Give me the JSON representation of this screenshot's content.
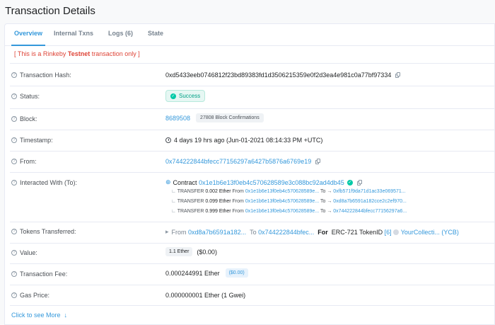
{
  "page": {
    "title": "Transaction Details"
  },
  "tabs": [
    {
      "label": "Overview"
    },
    {
      "label": "Internal Txns"
    },
    {
      "label": "Logs (6)"
    },
    {
      "label": "State"
    }
  ],
  "notice": {
    "prefix": "[ This is a Rinkeby ",
    "bold": "Testnet",
    "suffix": " transaction only ]"
  },
  "fields": {
    "hash": {
      "label": "Transaction Hash:",
      "value": "0xd5433eeb0746812f23bd89383fd1d3506215359e0f2d3ea4e981c0a77bf97334"
    },
    "status": {
      "label": "Status:",
      "value": "Success"
    },
    "block": {
      "label": "Block:",
      "value": "8689508",
      "confirmations": "27808 Block Confirmations"
    },
    "timestamp": {
      "label": "Timestamp:",
      "value": "4 days 19 hrs ago (Jun-01-2021 08:14:33 PM +UTC)"
    },
    "from": {
      "label": "From:",
      "value": "0x744222844bfecc77156297a6427b5876a6769e19"
    },
    "interacted": {
      "label": "Interacted With (To):",
      "prefix": "Contract",
      "address": "0x1e1b6e13f0eb4c570628589e3c088bc92ad4db45",
      "transfers": [
        {
          "kind": "TRANSFER",
          "amount": "0.002 Ether",
          "from_label": "From",
          "from": "0x1e1b6e13f0eb4c570628589e...",
          "to_label": "To →",
          "to": "0xfb571f9da71d1ac33e069571..."
        },
        {
          "kind": "TRANSFER",
          "amount": "0.099 Ether",
          "from_label": "From",
          "from": "0x1e1b6e13f0eb4c570628589e...",
          "to_label": "To →",
          "to": "0xd8a7b6591a182cce2c2ef970..."
        },
        {
          "kind": "TRANSFER",
          "amount": "0.999 Ether",
          "from_label": "From",
          "from": "0x1e1b6e13f0eb4c570628589e...",
          "to_label": "To →",
          "to": "0x744222844bfecc77156297a6..."
        }
      ]
    },
    "tokens": {
      "label": "Tokens Transferred:",
      "from_label": "From",
      "from": "0xd8a7b6591a182...",
      "to_label": "To",
      "to": "0x744222844bfec...",
      "for_label": "For",
      "standard": "ERC-721 TokenID",
      "token_id": "[6]",
      "token_name": "YourCollecti... (YCB)"
    },
    "value": {
      "label": "Value:",
      "amount": "1.1 Ether",
      "usd": "($0.00)"
    },
    "fee": {
      "label": "Transaction Fee:",
      "value": "0.000244991 Ether",
      "usd": "($0.00)"
    },
    "gas": {
      "label": "Gas Price:",
      "value": "0.000000001 Ether (1 Gwei)"
    }
  },
  "see_more": "Click to see More",
  "icons": {
    "question": "question-circle-icon",
    "copy": "copy-icon",
    "check": "check-circle-icon",
    "clock": "clock-icon",
    "contract": "contract-icon",
    "arrow_down": "arrow-down-icon"
  },
  "colors": {
    "link": "#3498db",
    "success": "#00a186",
    "notice": "#de4437"
  }
}
